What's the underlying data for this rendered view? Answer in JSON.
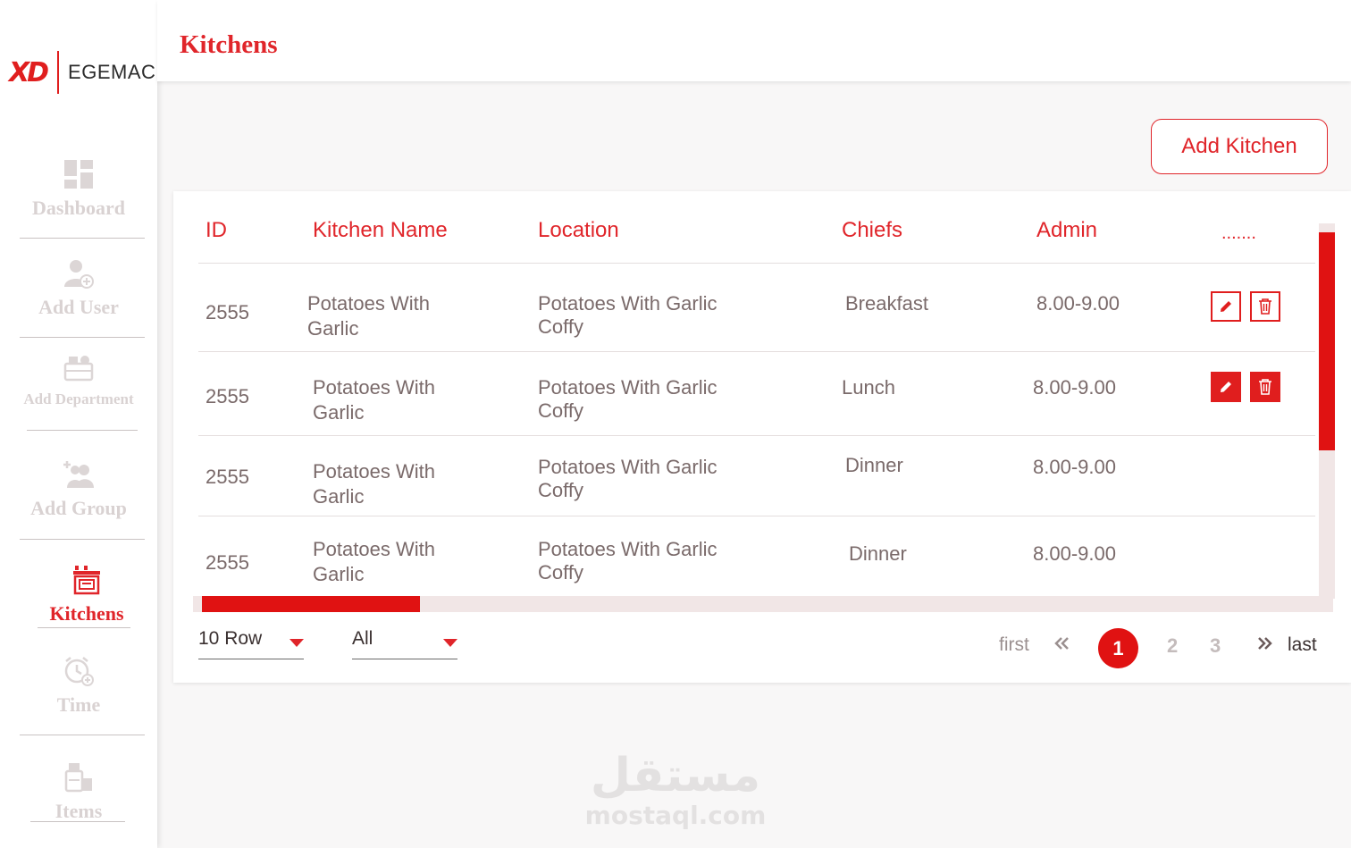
{
  "brand": {
    "mark": "XD",
    "name": "EGEMAC"
  },
  "colors": {
    "accent": "#e0252a",
    "muted_nav": "#d9d2d2",
    "text": "#7a6a6a"
  },
  "sidebar": {
    "items": [
      {
        "label": "Dashboard",
        "icon": "dashboard-icon",
        "active": false
      },
      {
        "label": "Add User",
        "icon": "add-user-icon",
        "active": false
      },
      {
        "label": "Add Department",
        "icon": "department-icon",
        "active": false
      },
      {
        "label": "Add Group",
        "icon": "add-group-icon",
        "active": false
      },
      {
        "label": "Kitchens",
        "icon": "kitchen-icon",
        "active": true
      },
      {
        "label": "Time",
        "icon": "alarm-clock-icon",
        "active": false
      },
      {
        "label": "Items",
        "icon": "items-icon",
        "active": false
      }
    ]
  },
  "header": {
    "title": "Kitchens"
  },
  "toolbar": {
    "add_label": "Add Kitchen"
  },
  "table": {
    "columns": [
      "ID",
      "Kitchen Name",
      "Location",
      "Chiefs",
      "Admin",
      "......."
    ],
    "rows": [
      {
        "id": "2555",
        "name_1": "Potatoes With",
        "name_2": "Garlic",
        "loc_1": "Potatoes With Garlic",
        "loc_2": "Coffy",
        "chief": "Breakfast",
        "admin": "8.00-9.00"
      },
      {
        "id": "2555",
        "name_1": "Potatoes With",
        "name_2": "Garlic",
        "loc_1": "Potatoes With Garlic",
        "loc_2": "Coffy",
        "chief": "Lunch",
        "admin": "8.00-9.00"
      },
      {
        "id": "2555",
        "name_1": "Potatoes With",
        "name_2": "Garlic",
        "loc_1": "Potatoes With Garlic",
        "loc_2": "Coffy",
        "chief": "Dinner",
        "admin": "8.00-9.00"
      },
      {
        "id": "2555",
        "name_1": "Potatoes With",
        "name_2": "Garlic",
        "loc_1": "Potatoes With Garlic",
        "loc_2": "Coffy",
        "chief": "Dinner",
        "admin": "8.00-9.00"
      }
    ]
  },
  "footer": {
    "rows_select": "10 Row",
    "filter_select": "All",
    "pagination": {
      "first": "first",
      "last": "last",
      "pages": [
        "1",
        "2",
        "3"
      ],
      "current": "1"
    }
  },
  "watermark": {
    "arabic": "مستقل",
    "latin": "mostaql.com"
  }
}
